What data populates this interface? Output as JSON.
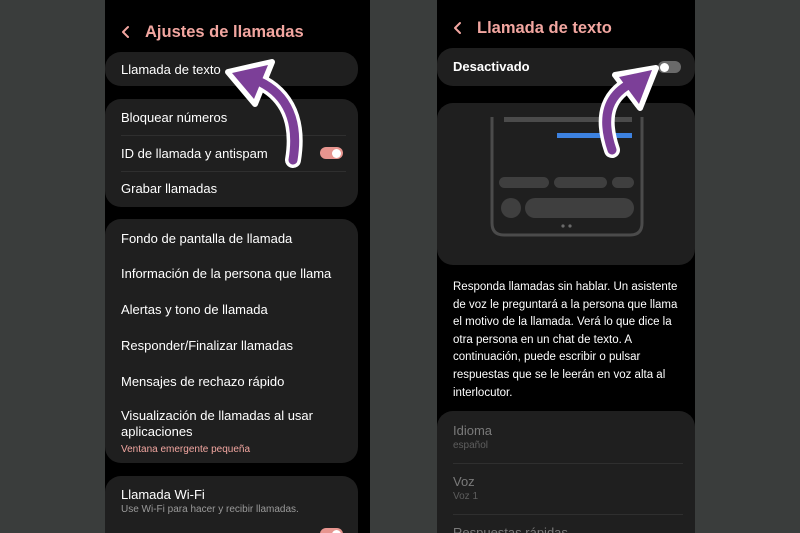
{
  "left_screen": {
    "title": "Ajustes de llamadas",
    "text_call": "Llamada de texto",
    "block_numbers": "Bloquear números",
    "caller_id": "ID de llamada y antispam",
    "caller_id_toggle": "on",
    "record_calls": "Grabar llamadas",
    "wallpaper": "Fondo de pantalla de llamada",
    "caller_info": "Información de la persona que llama",
    "alerts": "Alertas y tono de llamada",
    "answer_end": "Responder/Finalizar llamadas",
    "quick_decline": "Mensajes de rechazo rápido",
    "display_calls": "Visualización de llamadas al usar aplicaciones",
    "display_calls_sub": "Ventana emergente pequeña",
    "wifi_call": "Llamada Wi-Fi",
    "wifi_call_sub": "Use Wi-Fi para hacer y recibir llamadas."
  },
  "right_screen": {
    "title": "Llamada de texto",
    "master_switch_label": "Desactivado",
    "master_switch_state": "off",
    "description": "Responda llamadas sin hablar. Un asistente de voz le preguntará a la persona que llama el motivo de la llamada. Verá lo que dice la otra persona en un chat de texto. A continuación, puede escribir o pulsar respuestas que se le leerán en voz alta al interlocutor.",
    "language_label": "Idioma",
    "language_value": "español",
    "voice_label": "Voz",
    "voice_value": "Voz 1",
    "quick_replies_label": "Respuestas rápidas"
  },
  "colors": {
    "accent": "#f2a6a0",
    "arrow": "#7c3f98",
    "preview_blue": "#3d82e0",
    "background": "#3a3d3c"
  },
  "icons": [
    "back-arrow-icon",
    "pointer-arrow-icon"
  ]
}
